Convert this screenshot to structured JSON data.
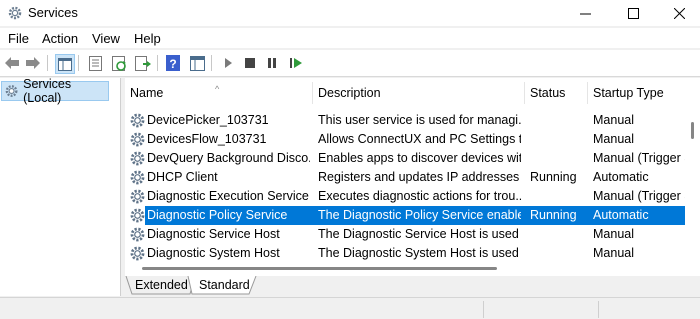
{
  "window": {
    "title": "Services",
    "minimize_glyph": "—",
    "maximize_glyph": "☐",
    "close_glyph": "✕"
  },
  "menu": {
    "items": [
      "File",
      "Action",
      "View",
      "Help"
    ]
  },
  "toolbar": {
    "icons": [
      "back-arrow-icon",
      "forward-arrow-icon",
      "show-hide-console-tree-icon",
      "properties-icon",
      "refresh-icon",
      "export-list-icon",
      "help-icon",
      "console-view-icon",
      "start-service-icon",
      "stop-service-icon",
      "pause-service-icon",
      "resume-service-icon"
    ]
  },
  "tree": {
    "label": "Services (Local)"
  },
  "table": {
    "columns": [
      "Name",
      "Description",
      "Status",
      "Startup Type"
    ],
    "sort_indicator": "^",
    "rows": [
      {
        "name": "DevicePicker_103731",
        "description": "This user service is used for managi...",
        "status": "",
        "startup": "Manual"
      },
      {
        "name": "DevicesFlow_103731",
        "description": "Allows ConnectUX and PC Settings t...",
        "status": "",
        "startup": "Manual"
      },
      {
        "name": "DevQuery Background Disco...",
        "description": "Enables apps to discover devices wit...",
        "status": "",
        "startup": "Manual (Trigger S"
      },
      {
        "name": "DHCP Client",
        "description": "Registers and updates IP addresses a...",
        "status": "Running",
        "startup": "Automatic"
      },
      {
        "name": "Diagnostic Execution Service",
        "description": "Executes diagnostic actions for trou...",
        "status": "",
        "startup": "Manual (Trigger S"
      },
      {
        "name": "Diagnostic Policy Service",
        "description": "The Diagnostic Policy Service enable...",
        "status": "Running",
        "startup": "Automatic"
      },
      {
        "name": "Diagnostic Service Host",
        "description": "The Diagnostic Service Host is used ...",
        "status": "",
        "startup": "Manual"
      },
      {
        "name": "Diagnostic System Host",
        "description": "The Diagnostic System Host is used ...",
        "status": "",
        "startup": "Manual"
      }
    ],
    "selected_index": 5
  },
  "tabs": [
    "Extended",
    "Standard"
  ],
  "active_tab": "Standard",
  "colors": {
    "selection": "#0078d7",
    "tree_selection": "#cce4f7"
  }
}
